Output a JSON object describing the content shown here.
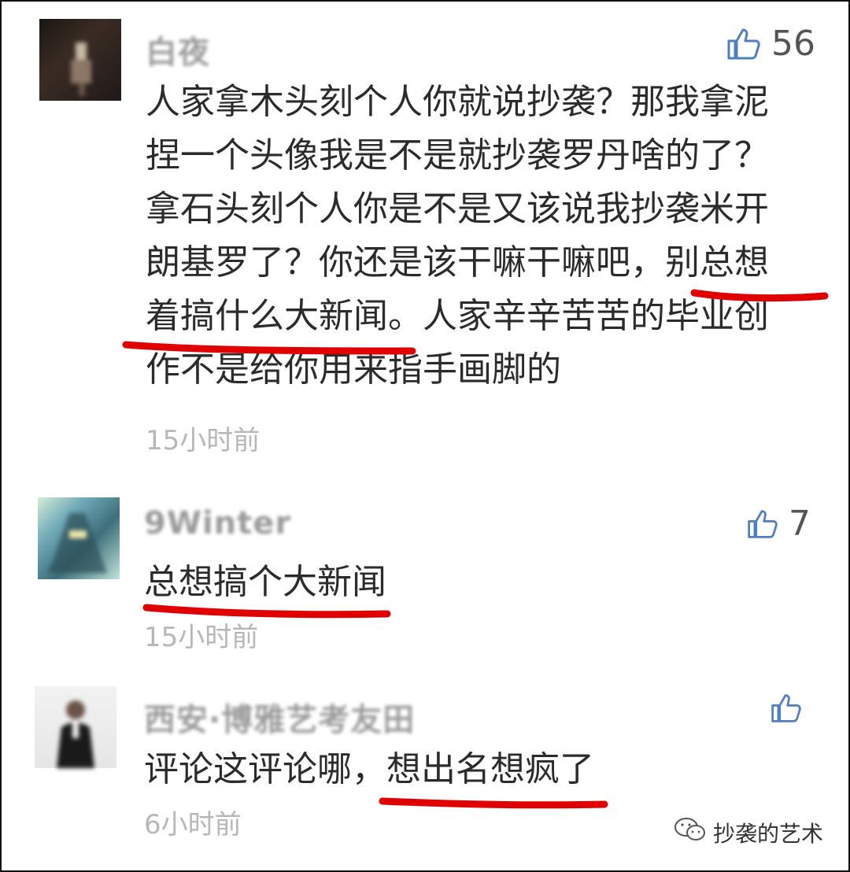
{
  "comments": [
    {
      "user": "白夜",
      "likes": "56",
      "text": [
        "人家拿木头刻个人你就说抄袭？那我拿泥",
        "捏一个头像我是不是就抄袭罗丹啥的了？",
        "拿石头刻个人你是不是又该说我抄袭米开",
        "朗基罗了？你还是该干嘛干嘛吧，别总想",
        "着搞什么大新闻。人家辛辛苦苦的毕业创",
        "作不是给你用来指手画脚的"
      ],
      "time": "15小时前"
    },
    {
      "user": "9Winter",
      "likes": "7",
      "text": [
        "总想搞个大新闻"
      ],
      "time": "15小时前"
    },
    {
      "user": "西安·博雅艺考友田",
      "likes": "",
      "text": [
        "评论这评论哪，想出名想疯了"
      ],
      "time": "6小时前"
    }
  ],
  "footer": {
    "label": "抄袭的艺术",
    "icon": "wechat-icon"
  },
  "colors": {
    "accent": "#4f7ec2",
    "underline": "#e00000",
    "time": "#b7b7b7"
  }
}
